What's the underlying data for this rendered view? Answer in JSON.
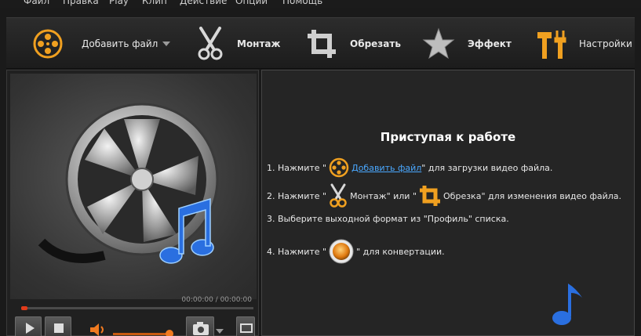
{
  "menu": [
    "Файл",
    "Правка",
    "Play",
    "Клип",
    "Действие",
    "Опции",
    "Помощь"
  ],
  "toolbar": {
    "add_file": "Добавить файл",
    "edit": "Монтаж",
    "crop": "Обрезать",
    "effect": "Эффект",
    "settings": "Настройки"
  },
  "player": {
    "time": "00:00:00 / 00:00:00",
    "progress": 0,
    "volume": 0.95
  },
  "getting_started": {
    "title": "Приступая к работе",
    "step1_pre": "1. Нажмите \"",
    "step1_link": " Добавить файл ",
    "step1_post": "\" для загрузки видео файла.",
    "step2_pre": "2. Нажмите \"",
    "step2_mid1": " Монтаж\" или \"",
    "step2_post": " Обрезка\" для изменения видео файла.",
    "step3": "3. Выберите выходной формат из \"Профиль\" списка.",
    "step4_pre": "4. Нажмите \"",
    "step4_post": "\" для конвертации."
  },
  "colors": {
    "accent": "#f0a020",
    "link": "#4aa8ff",
    "note": "#2a6fe0"
  }
}
